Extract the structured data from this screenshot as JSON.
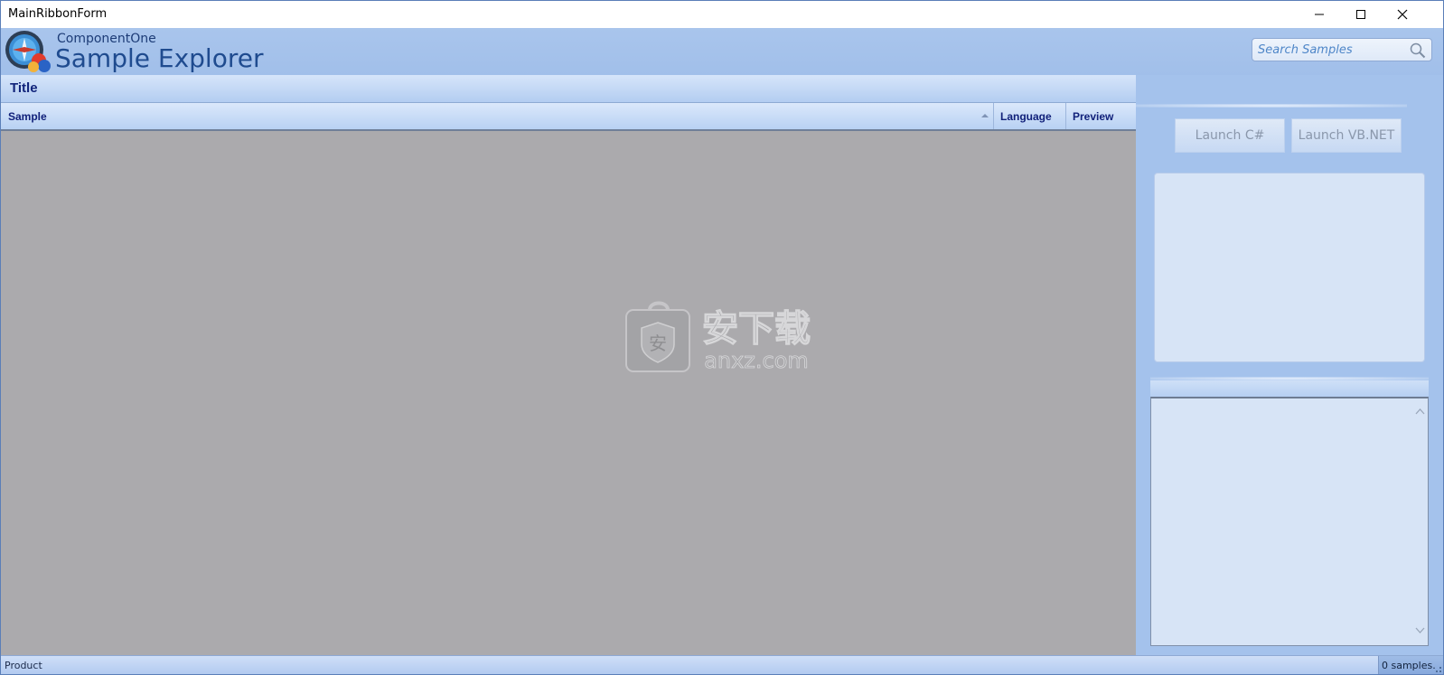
{
  "window": {
    "title": "MainRibbonForm"
  },
  "header": {
    "brand_small": "ComponentOne",
    "brand_big": "Sample Explorer",
    "search_placeholder": "Search Samples"
  },
  "grid": {
    "title": "Title",
    "columns": [
      "Sample",
      "Language",
      "Preview"
    ]
  },
  "watermark": {
    "cn_text": "安下载",
    "url_text": "anxz.com",
    "badge_char": "安"
  },
  "actions": {
    "launch_cs": "Launch C#",
    "launch_vb": "Launch VB.NET"
  },
  "status": {
    "left": "Product",
    "right": "0 samples."
  },
  "colors": {
    "accent": "#1f4b8f",
    "grid_bg": "#abaaad",
    "panel_bg": "#a4c2ec"
  }
}
